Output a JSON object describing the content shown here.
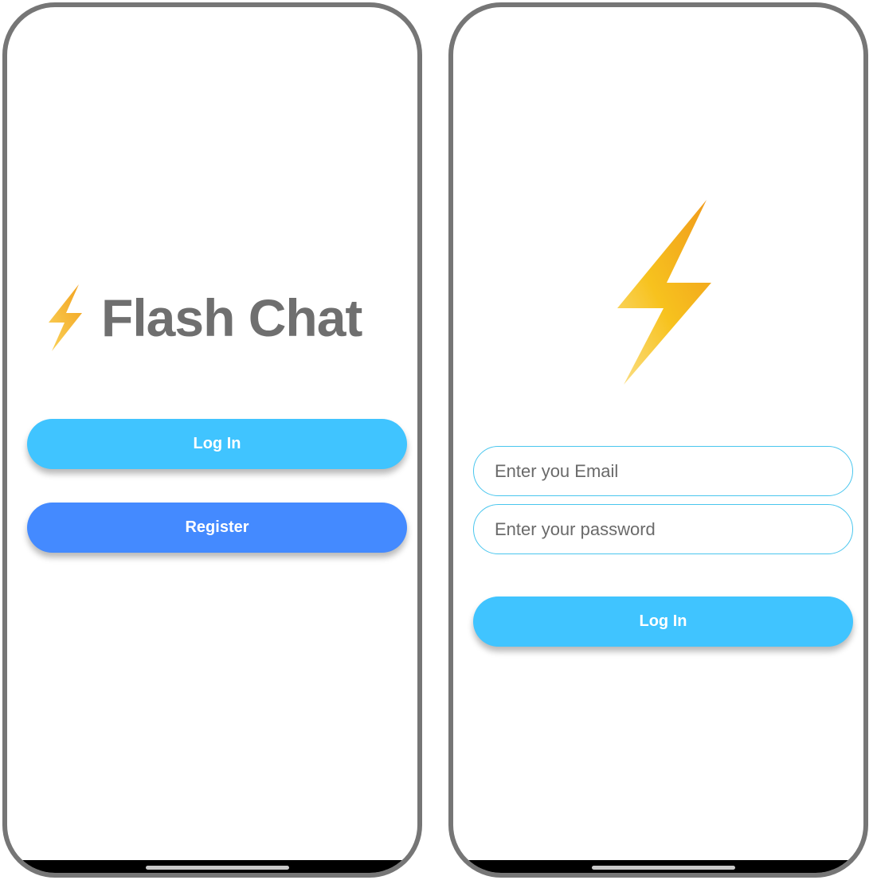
{
  "welcome": {
    "title": "Flash Chat",
    "login_label": "Log In",
    "register_label": "Register",
    "logo_icon": "lightning-bolt-icon"
  },
  "login": {
    "email_placeholder": "Enter you Email",
    "password_placeholder": "Enter your password",
    "login_label": "Log In",
    "logo_icon": "lightning-bolt-icon"
  },
  "colors": {
    "login_button": "#40c4ff",
    "register_button": "#448aff",
    "title_text": "#6f6f6f",
    "field_border": "#49c6ee",
    "bolt_light": "#fad35a",
    "bolt_dark": "#f2a11e",
    "phone_frame": "#767676"
  }
}
